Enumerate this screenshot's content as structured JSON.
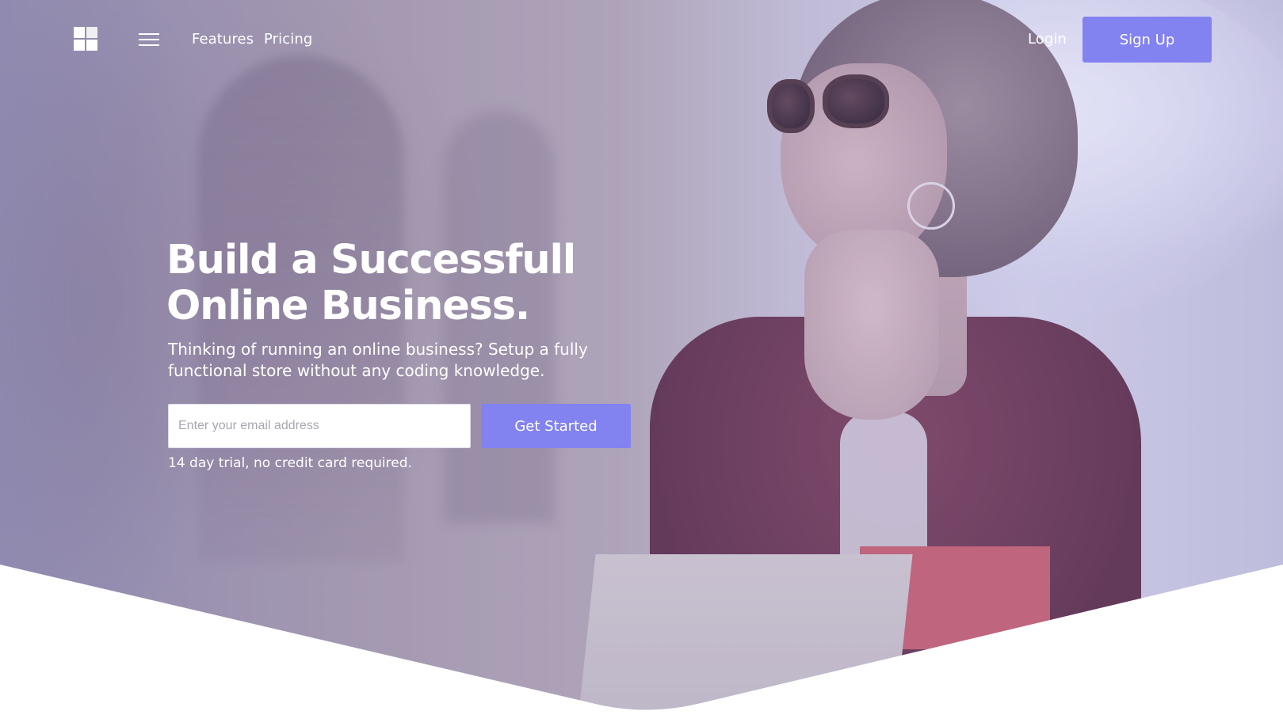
{
  "brand": {
    "logo_icon": "grid-logo-icon"
  },
  "nav": {
    "menu_icon": "hamburger-menu-icon",
    "links": [
      {
        "label": "Features"
      },
      {
        "label": "Pricing"
      }
    ],
    "login_label": "Login",
    "signup_label": "Sign Up"
  },
  "hero": {
    "headline_line1": "Build a Successfull",
    "headline_line2": "Online Business.",
    "subtext": "Thinking of running an online business? Setup a fully functional store without any coding knowledge.",
    "email_placeholder": "Enter your email address",
    "cta_label": "Get Started",
    "note": "14 day trial, no credit card required."
  },
  "colors": {
    "accent": "#8282f1",
    "text_on_hero": "#ffffff",
    "background": "#ffffff"
  }
}
